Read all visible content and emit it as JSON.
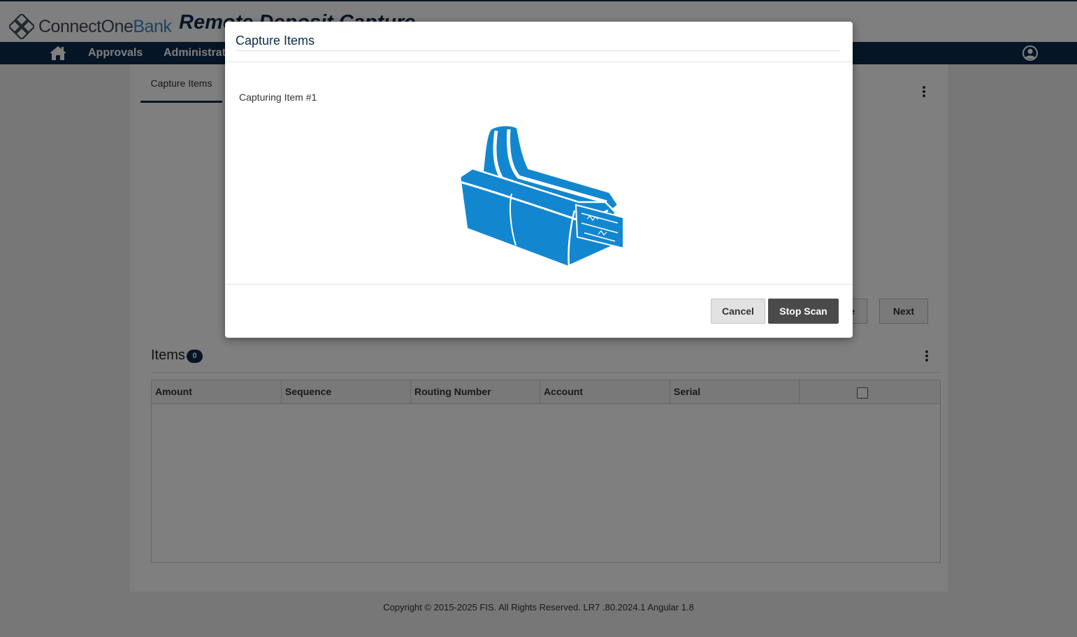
{
  "header": {
    "logo_name": "ConnectOne",
    "logo_bank": "Bank",
    "app_title": "Remote Deposit Capture"
  },
  "nav": {
    "home_icon": "home-icon",
    "items": [
      {
        "label": "Approvals"
      },
      {
        "label": "Administrat"
      }
    ],
    "user_icon": "user-circle-icon"
  },
  "capture": {
    "tab_label": "Capture Items",
    "back_button_partial": "e",
    "next_button": "Next"
  },
  "items": {
    "title": "Items",
    "count": "0",
    "columns": [
      "Amount",
      "Sequence",
      "Routing Number",
      "Account",
      "Serial"
    ],
    "rows": []
  },
  "footer": {
    "copyright": "Copyright © 2015-2025 FIS. All Rights Reserved. LR7 .80.2024.1 Angular 1.8"
  },
  "modal": {
    "title": "Capture Items",
    "status": "Capturing Item #1",
    "image_icon": "check-scanner-icon",
    "cancel_label": "Cancel",
    "stop_label": "Stop Scan"
  },
  "colors": {
    "navy": "#0d2a4a",
    "scanner_blue": "#1287d0",
    "stop_button": "#4a4a4a"
  }
}
